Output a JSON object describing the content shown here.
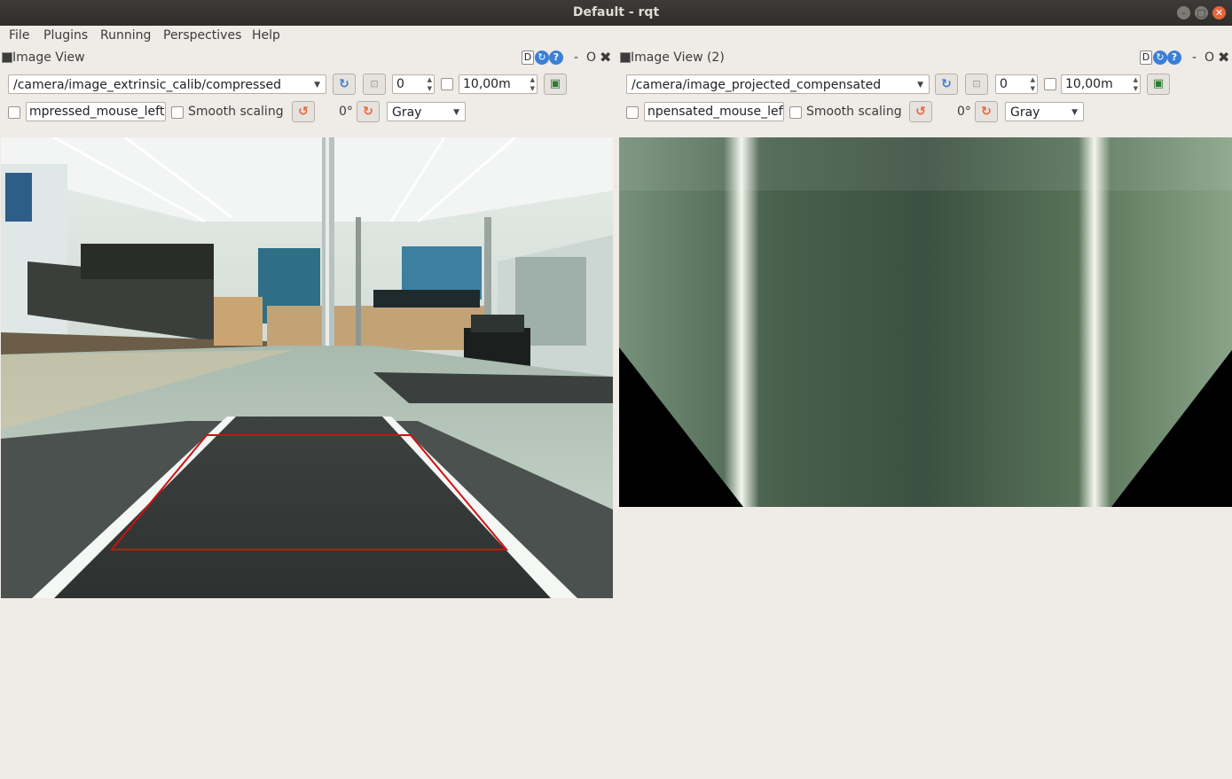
{
  "window": {
    "title": "Default - rqt"
  },
  "menu": {
    "file": "File",
    "plugins": "Plugins",
    "running": "Running",
    "perspectives": "Perspectives",
    "help": "Help"
  },
  "panel1": {
    "title": "Image View",
    "topic": "/camera/image_extrinsic_calib/compressed",
    "spin_value": "0",
    "distance": "10,00m",
    "mouse_topic": "mpressed_mouse_left",
    "smooth_label": "Smooth scaling",
    "rotation": "0°",
    "colormap": "Gray",
    "help_d": "D",
    "hdr_min": "-",
    "hdr_o": "O"
  },
  "panel2": {
    "title": "Image View (2)",
    "topic": "/camera/image_projected_compensated",
    "spin_value": "0",
    "distance": "10,00m",
    "mouse_topic": "npensated_mouse_left",
    "smooth_label": "Smooth scaling",
    "rotation": "0°",
    "colormap": "Gray",
    "help_d": "D",
    "hdr_min": "-",
    "hdr_o": "O"
  },
  "colors": {
    "accent": "#e9643a",
    "refresh_blue": "#3b7fd6",
    "overlay_red": "#d01010"
  }
}
